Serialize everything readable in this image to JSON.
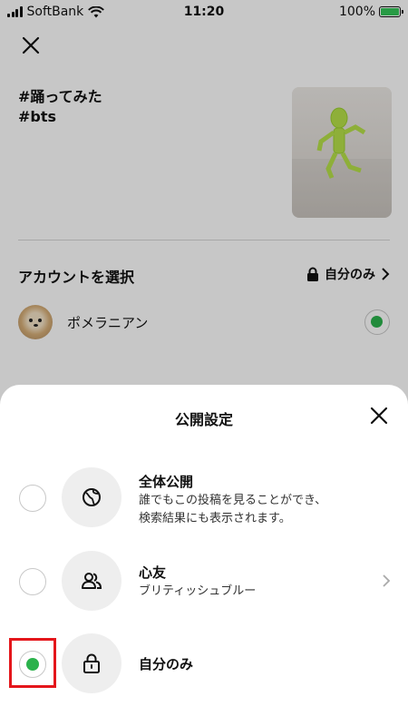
{
  "status_bar": {
    "carrier": "SoftBank",
    "time": "11:20",
    "battery": "100%"
  },
  "post": {
    "hashtag_1": "#踊ってみた",
    "hashtag_2": "#bts"
  },
  "account": {
    "section_label": "アカウントを選択",
    "privacy_value": "自分のみ",
    "name": "ポメラニアン"
  },
  "sheet": {
    "title": "公開設定",
    "options": [
      {
        "title": "全体公開",
        "desc_line1": "誰でもこの投稿を見ることができ、",
        "desc_line2": "検索結果にも表示されます。",
        "selected": false
      },
      {
        "title": "心友",
        "desc_line1": "ブリティッシュブルー",
        "selected": false
      },
      {
        "title": "自分のみ",
        "selected": true
      }
    ]
  },
  "colors": {
    "accent_green": "#2bb24c",
    "highlight_red": "#e4161b"
  }
}
